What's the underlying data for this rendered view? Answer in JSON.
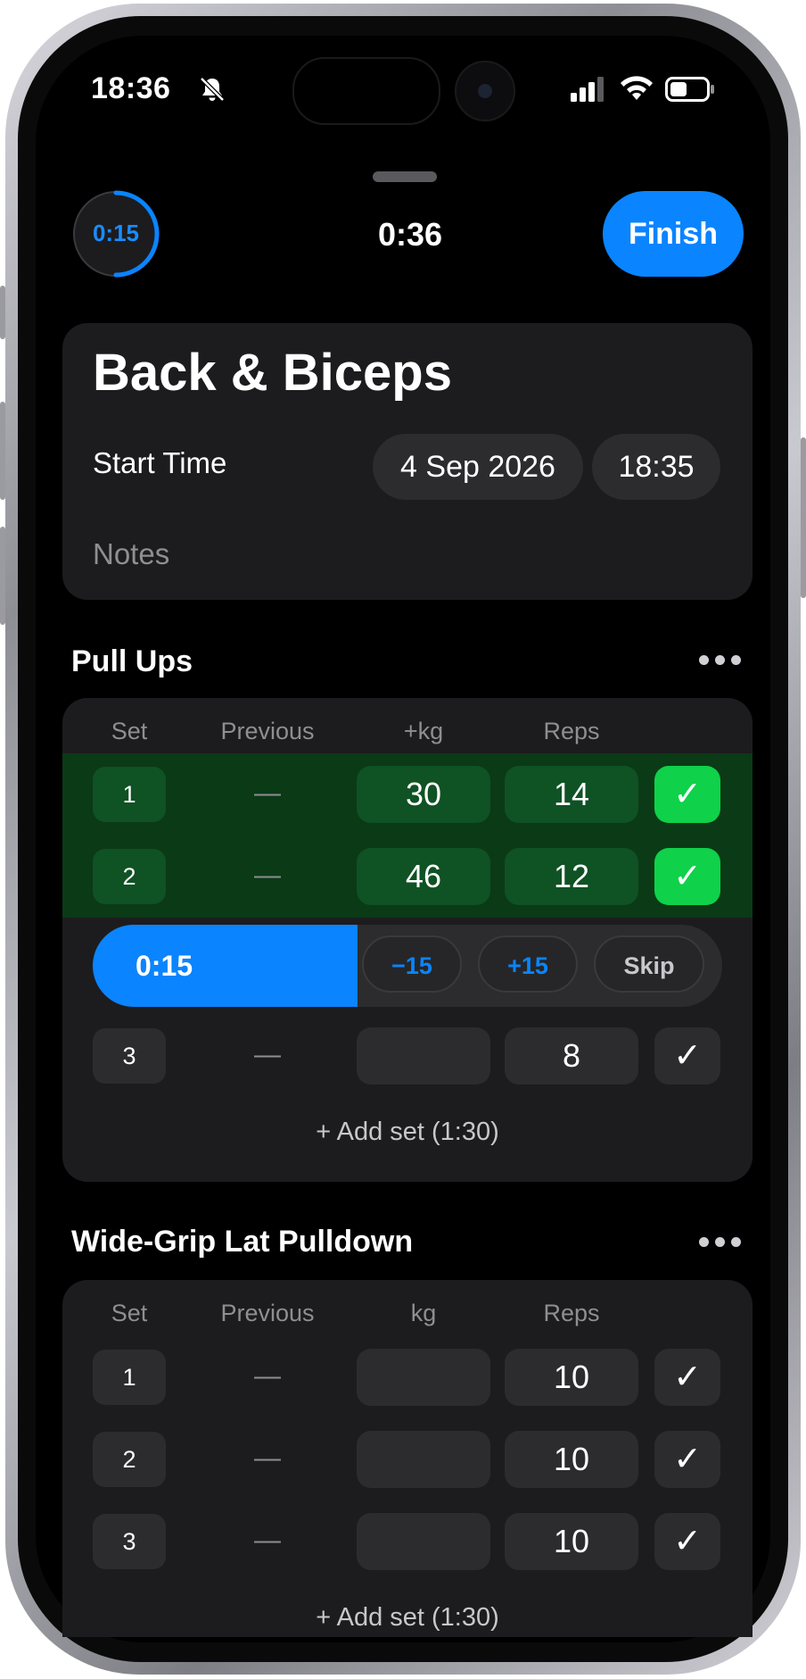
{
  "status_bar": {
    "time": "18:36"
  },
  "header": {
    "rest_timer": "0:15",
    "elapsed": "0:36",
    "finish_label": "Finish"
  },
  "workout": {
    "title": "Back & Biceps",
    "start_label": "Start Time",
    "start_date": "4 Sep 2026",
    "start_time": "18:35",
    "notes_placeholder": "Notes"
  },
  "exercises": [
    {
      "name": "Pull Ups",
      "columns": {
        "set": "Set",
        "previous": "Previous",
        "weight": "+kg",
        "reps": "Reps"
      },
      "sets": [
        {
          "set": "1",
          "previous": "—",
          "weight": "30",
          "reps": "14",
          "done": true
        },
        {
          "set": "2",
          "previous": "—",
          "weight": "46",
          "reps": "12",
          "done": true
        },
        {
          "set": "3",
          "previous": "—",
          "weight": "",
          "reps": "8",
          "done": false
        }
      ],
      "rest": {
        "time": "0:15",
        "progress": 0.42,
        "minus": "−15",
        "plus": "+15",
        "skip": "Skip"
      },
      "add_set": "+ Add set (1:30)"
    },
    {
      "name": "Wide-Grip Lat Pulldown",
      "columns": {
        "set": "Set",
        "previous": "Previous",
        "weight": "kg",
        "reps": "Reps"
      },
      "sets": [
        {
          "set": "1",
          "previous": "—",
          "weight": "",
          "reps": "10",
          "done": false
        },
        {
          "set": "2",
          "previous": "—",
          "weight": "",
          "reps": "10",
          "done": false
        },
        {
          "set": "3",
          "previous": "—",
          "weight": "",
          "reps": "10",
          "done": false
        }
      ],
      "add_set": "+ Add set (1:30)"
    }
  ],
  "check_glyph": "✓",
  "colors": {
    "accent": "#0a84ff",
    "done_row": "#0b3a16",
    "done_check": "#0fd14a"
  }
}
